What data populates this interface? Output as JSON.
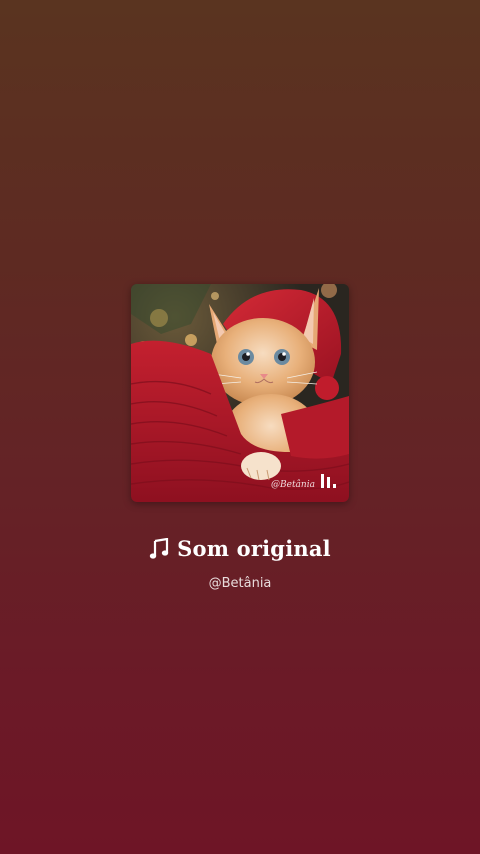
{
  "audio": {
    "title": "Som original",
    "author": "@Betânia",
    "cover_watermark": "@Betânia",
    "cover_image": "kitten-in-red-knit-blanket-and-santa-hat",
    "note_icon": "music-note-icon",
    "reels_icon": "reels-icon"
  },
  "colors": {
    "background_top": "#5a3420",
    "background_bottom": "#6e1526",
    "text_primary": "#ffffff",
    "text_secondary": "#e9dcdc",
    "blanket_red": "#b3182a"
  }
}
